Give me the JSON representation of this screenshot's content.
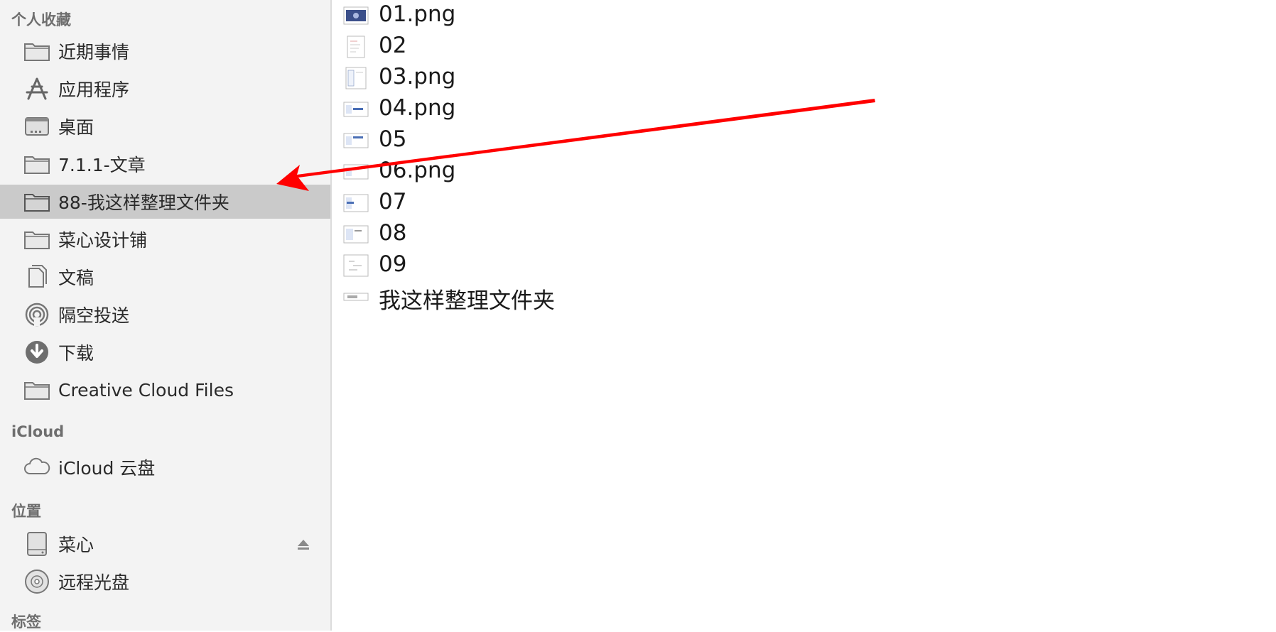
{
  "sidebar": {
    "favorites_header": "个人收藏",
    "favorites": [
      {
        "label": "近期事情",
        "icon": "folder-icon"
      },
      {
        "label": "应用程序",
        "icon": "applications-icon"
      },
      {
        "label": "桌面",
        "icon": "desktop-icon"
      },
      {
        "label": "7.1.1-文章",
        "icon": "folder-icon"
      },
      {
        "label": "88-我这样整理文件夹",
        "icon": "folder-icon",
        "selected": true
      },
      {
        "label": "菜心设计铺",
        "icon": "folder-icon"
      },
      {
        "label": "文稿",
        "icon": "documents-icon"
      },
      {
        "label": "隔空投送",
        "icon": "airdrop-icon"
      },
      {
        "label": "下载",
        "icon": "downloads-icon"
      },
      {
        "label": "Creative Cloud Files",
        "icon": "folder-icon"
      }
    ],
    "icloud_header": "iCloud",
    "icloud": [
      {
        "label": "iCloud 云盘",
        "icon": "cloud-icon"
      }
    ],
    "locations_header": "位置",
    "locations": [
      {
        "label": "菜心",
        "icon": "disk-icon",
        "eject": true
      },
      {
        "label": "远程光盘",
        "icon": "optical-disc-icon"
      }
    ],
    "tags_header": "标签"
  },
  "files": [
    {
      "name": "01.png",
      "thumb": "image-thumb-icon"
    },
    {
      "name": "02",
      "thumb": "document-thumb-icon"
    },
    {
      "name": "03.png",
      "thumb": "document-thumb-icon"
    },
    {
      "name": "04.png",
      "thumb": "screenshot-thumb-icon"
    },
    {
      "name": "05",
      "thumb": "screenshot-thumb-icon"
    },
    {
      "name": "06.png",
      "thumb": "screenshot-thumb-icon"
    },
    {
      "name": "07",
      "thumb": "screenshot-thumb-icon"
    },
    {
      "name": "08",
      "thumb": "screenshot-thumb-icon"
    },
    {
      "name": "09",
      "thumb": "document-thumb-icon"
    },
    {
      "name": "我这样整理文件夹",
      "thumb": "banner-thumb-icon"
    }
  ],
  "annotation": {
    "type": "red-arrow",
    "color": "#ff0000",
    "points_to": "88-我这样整理文件夹"
  },
  "colors": {
    "sidebar_bg": "#f3f3f3",
    "selected_bg": "#cacaca",
    "icon_gray": "#7a7a7a"
  }
}
